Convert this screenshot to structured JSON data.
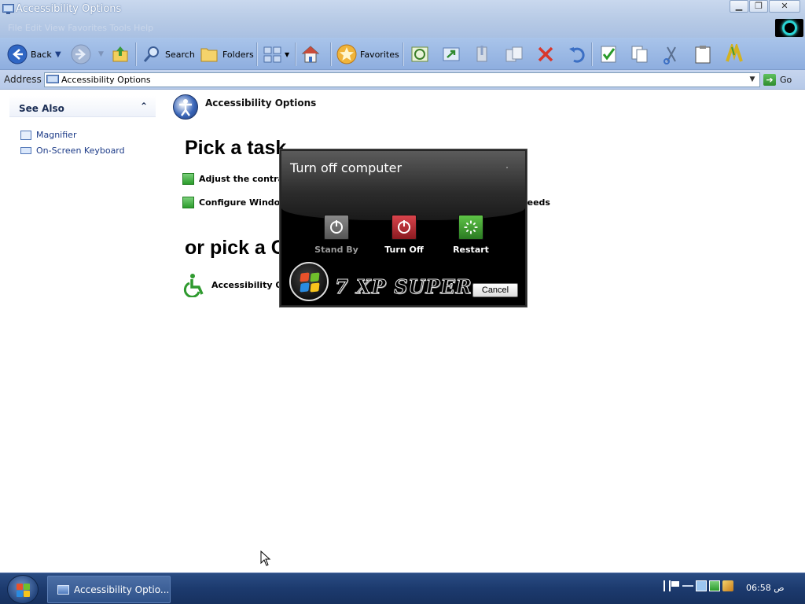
{
  "window": {
    "title": "Accessibility Options",
    "menubar_ghost": "File   Edit   View   Favorites   Tools   Help",
    "controls": [
      "minimize",
      "restore",
      "close"
    ]
  },
  "toolbar": {
    "back_label": "Back",
    "search_label": "Search",
    "folders_label": "Folders",
    "favorites_label": "Favorites"
  },
  "address": {
    "label": "Address",
    "value": "Accessibility Options",
    "go_label": "Go"
  },
  "see_also": {
    "header": "See Also",
    "items": [
      {
        "label": "Magnifier",
        "icon": "magnifier-icon"
      },
      {
        "label": "On-Screen Keyboard",
        "icon": "keyboard-icon"
      }
    ]
  },
  "main": {
    "category_title": "Accessibility Options",
    "pick_task_heading": "Pick a task",
    "tasks": [
      "Adjust the contrast for text and colors on your screen",
      "Configure Windows to work for your vision, hearing, and mobility needs"
    ],
    "pick_icon_heading": "or pick a Control Panel icon",
    "icons": [
      "Accessibility Options"
    ]
  },
  "dialog": {
    "title": "Turn off computer",
    "buttons": [
      {
        "label": "Stand By",
        "color": "#6b6b6b"
      },
      {
        "label": "Turn Off",
        "color": "#b0242c"
      },
      {
        "label": "Restart",
        "color": "#3d9a2c"
      }
    ],
    "brand": "7 XP SUPER",
    "cancel_label": "Cancel"
  },
  "taskbar": {
    "task_label": "Accessibility Optio...",
    "clock": "06:58 ص"
  }
}
